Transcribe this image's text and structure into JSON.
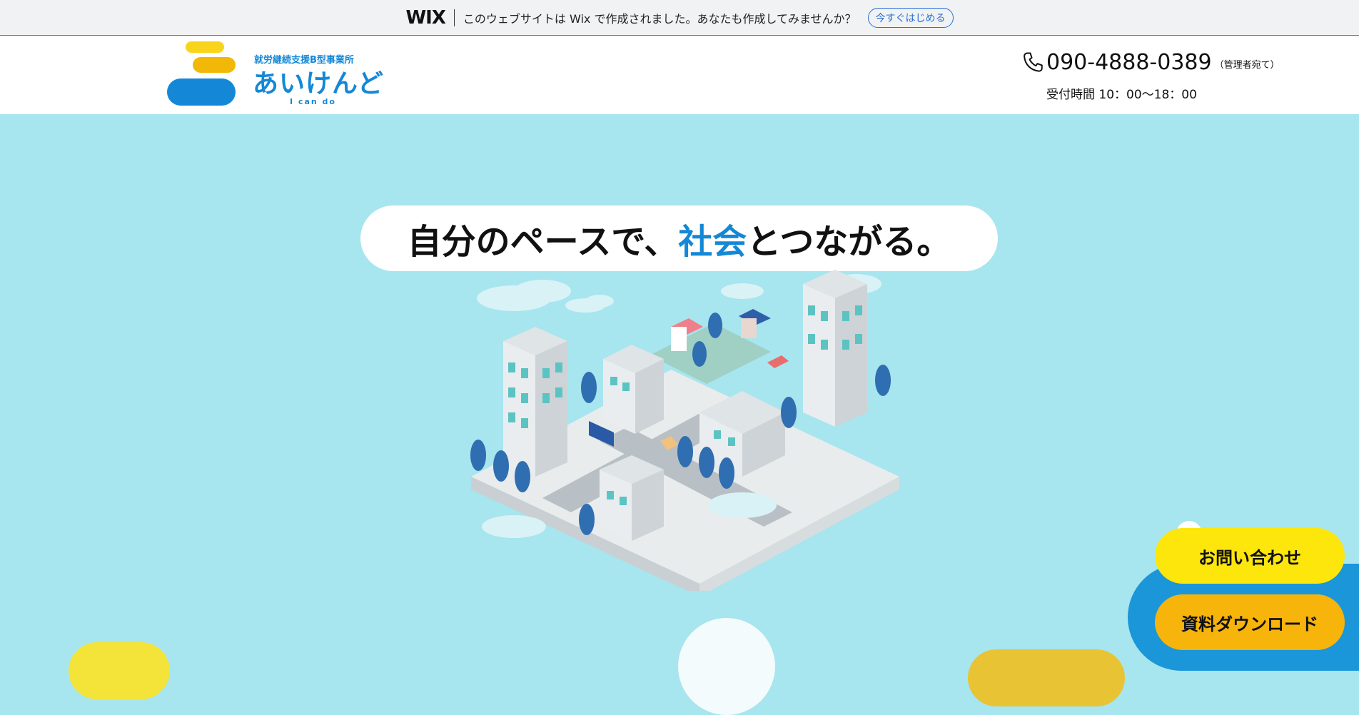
{
  "wix_banner": {
    "logo": "WIX",
    "message": "このウェブサイトは Wix で作成されました。あなたも作成してみませんか？",
    "cta": "今すぐはじめる"
  },
  "header": {
    "logo_subtitle": "就労継続支援B型事業所",
    "logo_title": "あいけんど",
    "logo_english": "I can do",
    "phone_number": "090-4888-0389",
    "phone_note": "（管理者宛て）",
    "hours": "受付時間 10：00〜18：00"
  },
  "hero": {
    "tagline_before": "自分のペースで、",
    "tagline_accent": "社会",
    "tagline_after": "とつながる。"
  },
  "floating": {
    "contact_label": "お問い合わせ",
    "docs_label": "資料ダウンロード"
  },
  "colors": {
    "brand_blue": "#1488d6",
    "hero_bg": "#a7e5ef",
    "yellow": "#fde60c",
    "orange": "#f7b40b"
  }
}
